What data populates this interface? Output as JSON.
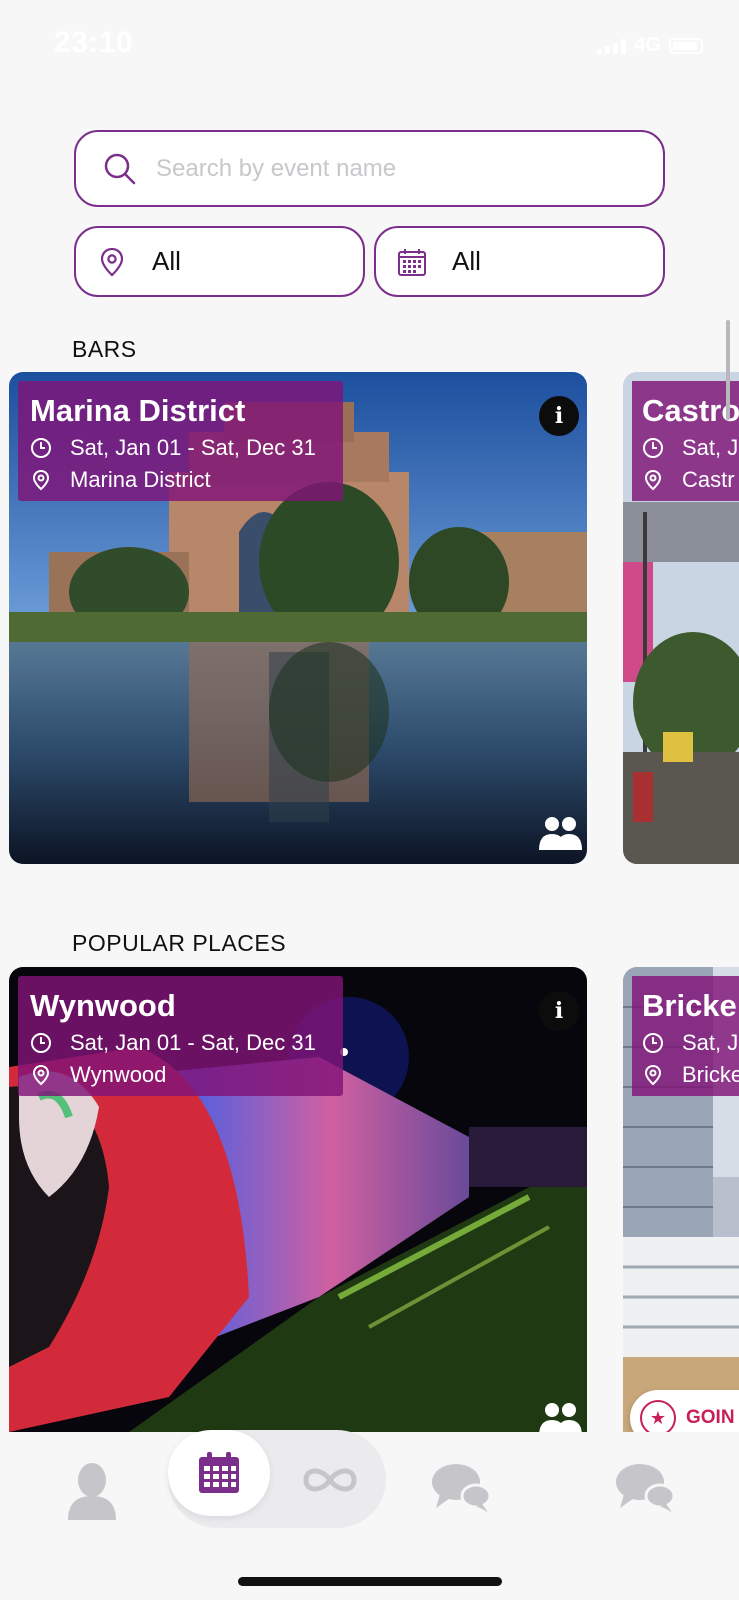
{
  "status": {
    "time": "23:10",
    "network": "4G"
  },
  "search": {
    "placeholder": "Search by event name",
    "value": ""
  },
  "filters": {
    "location": {
      "icon": "map-pin-icon",
      "value": "All"
    },
    "date": {
      "icon": "calendar-icon",
      "value": "All"
    }
  },
  "sections": [
    {
      "title": "BARS",
      "cards": [
        {
          "title": "Marina District",
          "dates": "Sat, Jan 01 - Sat, Dec 31",
          "location": "Marina District"
        },
        {
          "title": "Castro",
          "dates": "Sat, J",
          "location": "Castr"
        }
      ]
    },
    {
      "title": "POPULAR PLACES",
      "cards": [
        {
          "title": "Wynwood",
          "dates": "Sat, Jan 01 - Sat, Dec 31",
          "location": "Wynwood"
        },
        {
          "title": "Bricke",
          "dates": "Sat, J",
          "location": "Bricke"
        }
      ]
    }
  ],
  "going_label": "GOIN",
  "tabs": [
    {
      "name": "profile",
      "icon": "person-icon"
    },
    {
      "name": "events",
      "icon": "calendar-icon",
      "active": true
    },
    {
      "name": "connect",
      "icon": "infinity-logo-icon"
    },
    {
      "name": "chat",
      "icon": "chat-bubbles-icon"
    },
    {
      "name": "messages",
      "icon": "chat-bubbles-icon"
    }
  ],
  "colors": {
    "accent": "#7b2f8a",
    "overlay": "#80147a",
    "going": "#c81e5a"
  }
}
